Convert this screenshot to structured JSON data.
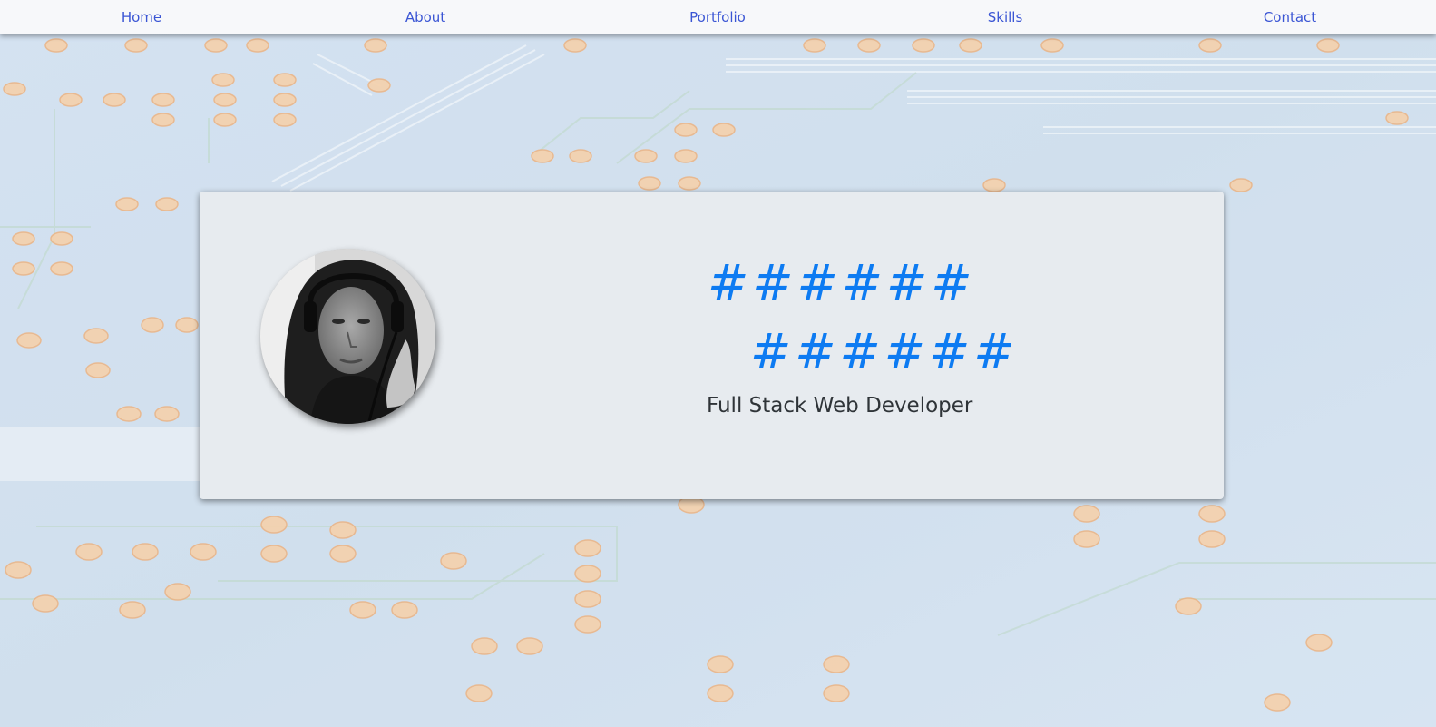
{
  "nav": {
    "items": [
      {
        "label": "Home"
      },
      {
        "label": "About"
      },
      {
        "label": "Portfolio"
      },
      {
        "label": "Skills"
      },
      {
        "label": "Contact"
      }
    ]
  },
  "hero": {
    "line1": "######",
    "line2": "######",
    "subtitle": "Full Stack Web Developer"
  },
  "colors": {
    "nav_link": "#3a55d4",
    "accent": "#0d7bf2",
    "card_bg": "#e7ebef",
    "background": "#c9dbee"
  }
}
